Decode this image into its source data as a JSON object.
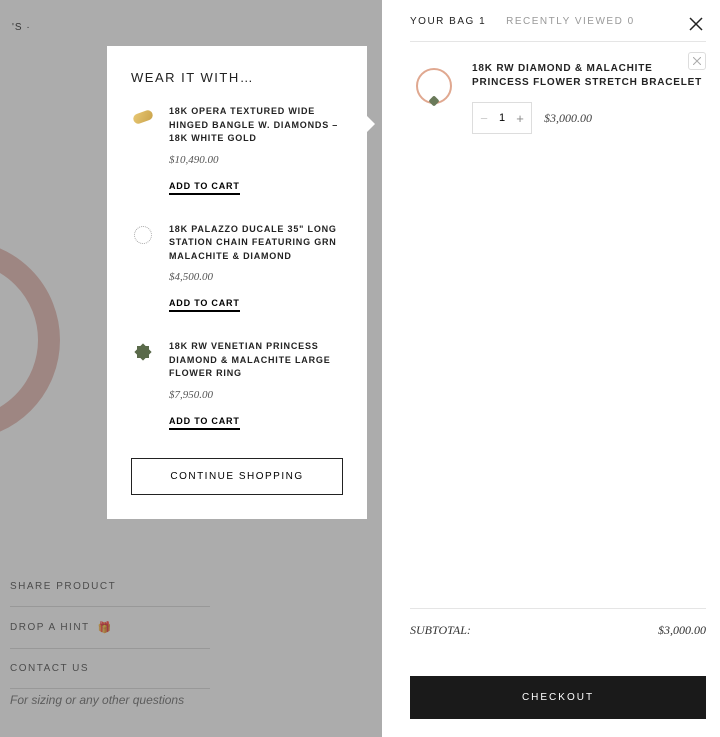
{
  "header": {
    "nav_fragment": "'S ·",
    "search_label": "S"
  },
  "background": {
    "share_label": "SHARE PRODUCT",
    "drop_hint_label": "DROP A HINT",
    "contact_label": "CONTACT US",
    "sizing_note": "For sizing or any other questions"
  },
  "modal": {
    "title": "WEAR IT WITH…",
    "continue_label": "CONTINUE SHOPPING",
    "add_to_cart_label": "ADD TO CART",
    "items": [
      {
        "name": "18K OPERA TEXTURED WIDE HINGED BANGLE W. DIAMONDS – 18K WHITE GOLD",
        "price": "$10,490.00"
      },
      {
        "name": "18K PALAZZO DUCALE 35\" LONG STATION CHAIN FEATURING GRN MALACHITE & DIAMOND",
        "price": "$4,500.00"
      },
      {
        "name": "18K RW VENETIAN PRINCESS DIAMOND & MALACHITE LARGE FLOWER RING",
        "price": "$7,950.00"
      }
    ]
  },
  "cart": {
    "tabs": {
      "bag_label": "YOUR BAG",
      "bag_count": "1",
      "recent_label": "RECENTLY VIEWED",
      "recent_count": "0"
    },
    "item": {
      "name": "18K RW DIAMOND & MALACHITE PRINCESS FLOWER STRETCH BRACELET",
      "qty": "1",
      "price": "$3,000.00"
    },
    "subtotal_label": "SUBTOTAL:",
    "subtotal_value": "$3,000.00",
    "checkout_label": "CHECKOUT"
  }
}
